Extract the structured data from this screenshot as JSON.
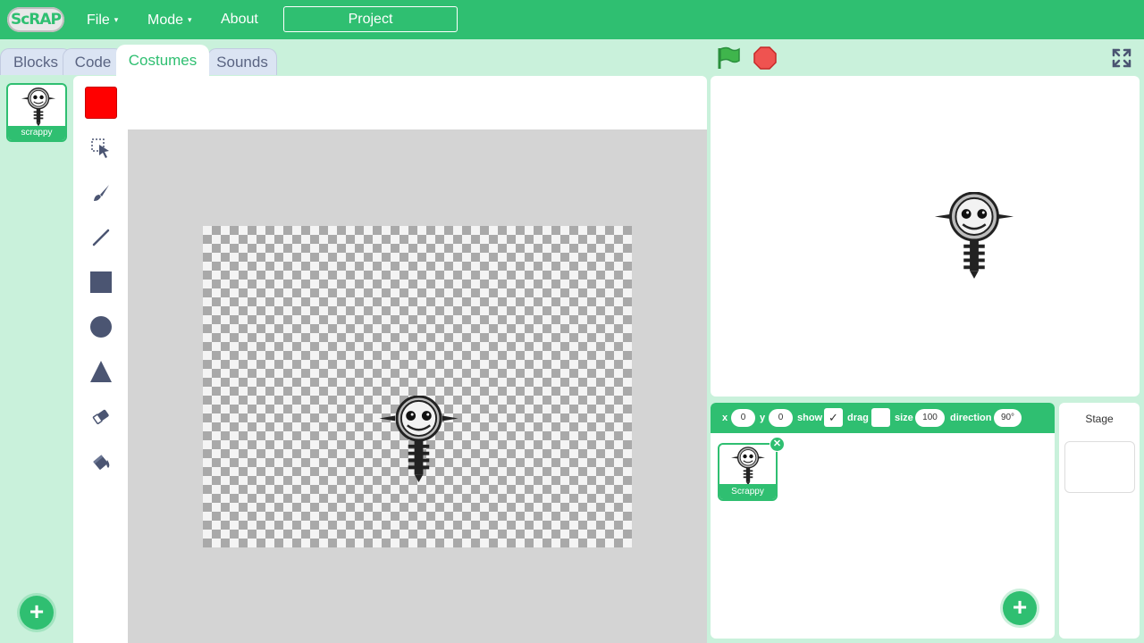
{
  "menubar": {
    "logo": "ScRAP",
    "file": "File",
    "mode": "Mode",
    "about": "About",
    "project_title": "Project",
    "caret": "▾"
  },
  "tabs": [
    {
      "label": "Blocks"
    },
    {
      "label": "Code"
    },
    {
      "label": "Costumes",
      "active": true
    },
    {
      "label": "Sounds"
    }
  ],
  "costumes": [
    {
      "name": "scrappy"
    }
  ],
  "paint_editor": {
    "fill_color": "#ff0000",
    "tools": [
      "select-icon",
      "brush-icon",
      "line-icon",
      "rectangle-icon",
      "circle-icon",
      "triangle-icon",
      "eraser-icon",
      "fill-icon"
    ]
  },
  "sprite_info": {
    "x_label": "x",
    "x": "0",
    "y_label": "y",
    "y": "0",
    "show_label": "show",
    "show_checked": "✓",
    "drag_label": "drag",
    "size_label": "size",
    "size": "100",
    "direction_label": "direction",
    "direction": "90°"
  },
  "sprites": [
    {
      "name": "Scrappy"
    }
  ],
  "delete_glyph": "✕",
  "add_glyph": "+",
  "stage": {
    "label": "Stage"
  },
  "colors": {
    "accent": "#2fbf71",
    "background": "#c9f1db",
    "tab_inactive": "#dbe4f3"
  }
}
